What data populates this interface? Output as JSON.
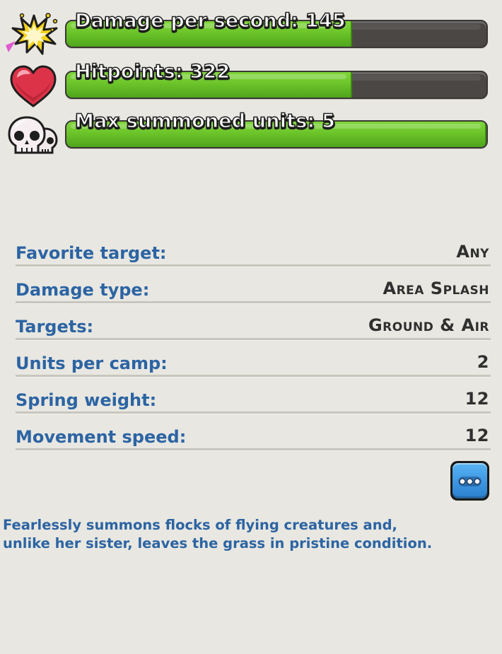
{
  "stats": [
    {
      "id": "dps",
      "label": "Damage per second: 145",
      "icon": "explosion-icon",
      "fill_fraction": 0.68
    },
    {
      "id": "hp",
      "label": "Hitpoints: 322",
      "icon": "heart-icon",
      "fill_fraction": 0.68
    },
    {
      "id": "units",
      "label": "Max summoned units: 5",
      "icon": "skulls-icon",
      "fill_fraction": 1.0
    }
  ],
  "info": [
    {
      "label": "Favorite target:",
      "value": "Any"
    },
    {
      "label": "Damage type:",
      "value": "Area Splash"
    },
    {
      "label": "Targets:",
      "value": "Ground & Air"
    },
    {
      "label": "Units per camp:",
      "value": "2"
    },
    {
      "label": "Spring weight:",
      "value": "12"
    },
    {
      "label": "Movement speed:",
      "value": "12"
    }
  ],
  "more_button": {
    "icon": "more-dots-icon"
  },
  "description": {
    "line1": "Fearlessly summons flocks of flying creatures and,",
    "line2": "unlike her sister, leaves the grass in pristine condition."
  },
  "colors": {
    "background": "#e8e7e1",
    "label_blue": "#2c64a3",
    "bar_green": "#6cc42a",
    "bar_track": "#4a4745",
    "button_blue": "#3f98e3"
  }
}
